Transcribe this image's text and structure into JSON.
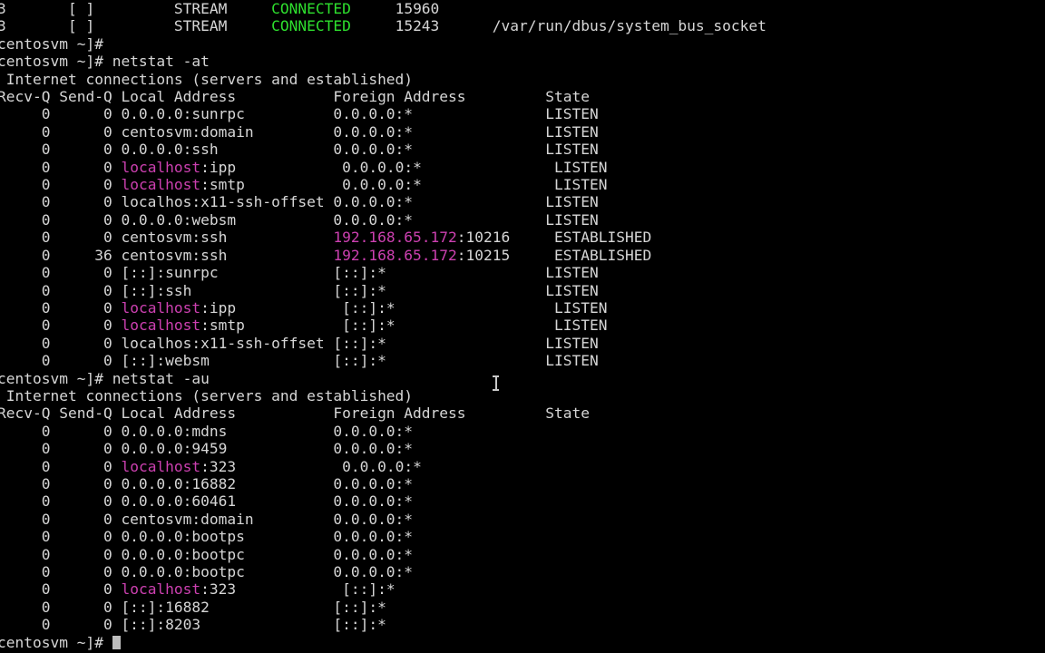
{
  "terminal": {
    "background_color": "#000000",
    "foreground_color": "#d6d6d6",
    "green_color": "#2ee02e",
    "magenta_color": "#cc40b0",
    "cursor_color": "#bdbdbd",
    "columns": 119,
    "rows": 37,
    "prompt": "centosvm ~]# ",
    "mouse_cursor_icon": "text-ibeam-cursor"
  },
  "lines": [
    {
      "id": "unix-socket-row-1",
      "segments": [
        {
          "text": "3       [ ]         STREAM     ",
          "color": "w"
        },
        {
          "text": "CONNECTED",
          "color": "gr"
        },
        {
          "text": "     15960",
          "color": "w"
        }
      ]
    },
    {
      "id": "unix-socket-row-2",
      "segments": [
        {
          "text": "3       [ ]         STREAM     ",
          "color": "w"
        },
        {
          "text": "CONNECTED",
          "color": "gr"
        },
        {
          "text": "     15243      /var/run/dbus/system_bus_socket",
          "color": "w"
        }
      ]
    },
    {
      "id": "prompt-blank",
      "segments": [
        {
          "text": "centosvm ~]# ",
          "color": "w"
        }
      ]
    },
    {
      "id": "prompt-netstat-at",
      "segments": [
        {
          "text": "centosvm ~]# netstat -at",
          "color": "w"
        }
      ]
    },
    {
      "id": "tcp-banner",
      "segments": [
        {
          "text": " Internet connections (servers and established)",
          "color": "w"
        }
      ]
    },
    {
      "id": "tcp-header",
      "segments": [
        {
          "text": "Recv-Q Send-Q Local Address           Foreign Address         State",
          "color": "w"
        }
      ]
    },
    {
      "id": "tcp-row-sunrpc",
      "segments": [
        {
          "text": "     0      0 0.0.0.0:sunrpc          0.0.0.0:*               LISTEN",
          "color": "w"
        }
      ]
    },
    {
      "id": "tcp-row-domain",
      "segments": [
        {
          "text": "     0      0 centosvm:domain         0.0.0.0:*               LISTEN",
          "color": "w"
        }
      ]
    },
    {
      "id": "tcp-row-ssh",
      "segments": [
        {
          "text": "     0      0 0.0.0.0:ssh             0.0.0.0:*               LISTEN",
          "color": "w"
        }
      ]
    },
    {
      "id": "tcp-row-ipp",
      "segments": [
        {
          "text": "     0      0 ",
          "color": "w"
        },
        {
          "text": "localhost",
          "color": "mg"
        },
        {
          "text": ":ipp            0.0.0.0:*               LISTEN",
          "color": "w"
        }
      ]
    },
    {
      "id": "tcp-row-smtp",
      "segments": [
        {
          "text": "     0      0 ",
          "color": "w"
        },
        {
          "text": "localhost",
          "color": "mg"
        },
        {
          "text": ":smtp           0.0.0.0:*               LISTEN",
          "color": "w"
        }
      ]
    },
    {
      "id": "tcp-row-x11",
      "segments": [
        {
          "text": "     0      0 localhos:x11-ssh-offset 0.0.0.0:*               LISTEN",
          "color": "w"
        }
      ]
    },
    {
      "id": "tcp-row-websm",
      "segments": [
        {
          "text": "     0      0 0.0.0.0:websm           0.0.0.0:*               LISTEN",
          "color": "w"
        }
      ]
    },
    {
      "id": "tcp-row-est-10216",
      "segments": [
        {
          "text": "     0      0 centosvm:ssh            ",
          "color": "w"
        },
        {
          "text": "192.168.65.172",
          "color": "mg"
        },
        {
          "text": ":10216     ESTABLISHED",
          "color": "w"
        }
      ]
    },
    {
      "id": "tcp-row-est-10215",
      "segments": [
        {
          "text": "     0     36 centosvm:ssh            ",
          "color": "w"
        },
        {
          "text": "192.168.65.172",
          "color": "mg"
        },
        {
          "text": ":10215     ESTABLISHED",
          "color": "w"
        }
      ]
    },
    {
      "id": "tcp6-row-sunrpc",
      "segments": [
        {
          "text": "     0      0 [::]:sunrpc             [::]:*                  LISTEN",
          "color": "w"
        }
      ]
    },
    {
      "id": "tcp6-row-ssh",
      "segments": [
        {
          "text": "     0      0 [::]:ssh                [::]:*                  LISTEN",
          "color": "w"
        }
      ]
    },
    {
      "id": "tcp6-row-ipp",
      "segments": [
        {
          "text": "     0      0 ",
          "color": "w"
        },
        {
          "text": "localhost",
          "color": "mg"
        },
        {
          "text": ":ipp            [::]:*                  LISTEN",
          "color": "w"
        }
      ]
    },
    {
      "id": "tcp6-row-smtp",
      "segments": [
        {
          "text": "     0      0 ",
          "color": "w"
        },
        {
          "text": "localhost",
          "color": "mg"
        },
        {
          "text": ":smtp           [::]:*                  LISTEN",
          "color": "w"
        }
      ]
    },
    {
      "id": "tcp6-row-x11",
      "segments": [
        {
          "text": "     0      0 localhos:x11-ssh-offset [::]:*                  LISTEN",
          "color": "w"
        }
      ]
    },
    {
      "id": "tcp6-row-websm",
      "segments": [
        {
          "text": "     0      0 [::]:websm              [::]:*                  LISTEN",
          "color": "w"
        }
      ]
    },
    {
      "id": "prompt-netstat-au",
      "segments": [
        {
          "text": "centosvm ~]# netstat -au",
          "color": "w"
        }
      ]
    },
    {
      "id": "udp-banner",
      "segments": [
        {
          "text": " Internet connections (servers and established)",
          "color": "w"
        }
      ]
    },
    {
      "id": "udp-header",
      "segments": [
        {
          "text": "Recv-Q Send-Q Local Address           Foreign Address         State",
          "color": "w"
        }
      ]
    },
    {
      "id": "udp-row-mdns",
      "segments": [
        {
          "text": "     0      0 0.0.0.0:mdns            0.0.0.0:*",
          "color": "w"
        }
      ]
    },
    {
      "id": "udp-row-9459",
      "segments": [
        {
          "text": "     0      0 0.0.0.0:9459            0.0.0.0:*",
          "color": "w"
        }
      ]
    },
    {
      "id": "udp-row-323",
      "segments": [
        {
          "text": "     0      0 ",
          "color": "w"
        },
        {
          "text": "localhost",
          "color": "mg"
        },
        {
          "text": ":323            0.0.0.0:*",
          "color": "w"
        }
      ]
    },
    {
      "id": "udp-row-16882",
      "segments": [
        {
          "text": "     0      0 0.0.0.0:16882           0.0.0.0:*",
          "color": "w"
        }
      ]
    },
    {
      "id": "udp-row-60461",
      "segments": [
        {
          "text": "     0      0 0.0.0.0:60461           0.0.0.0:*",
          "color": "w"
        }
      ]
    },
    {
      "id": "udp-row-domain",
      "segments": [
        {
          "text": "     0      0 centosvm:domain         0.0.0.0:*",
          "color": "w"
        }
      ]
    },
    {
      "id": "udp-row-bootps",
      "segments": [
        {
          "text": "     0      0 0.0.0.0:bootps          0.0.0.0:*",
          "color": "w"
        }
      ]
    },
    {
      "id": "udp-row-bootpc-1",
      "segments": [
        {
          "text": "     0      0 0.0.0.0:bootpc          0.0.0.0:*",
          "color": "w"
        }
      ]
    },
    {
      "id": "udp-row-bootpc-2",
      "segments": [
        {
          "text": "     0      0 0.0.0.0:bootpc          0.0.0.0:*",
          "color": "w"
        }
      ]
    },
    {
      "id": "udp6-row-323",
      "segments": [
        {
          "text": "     0      0 ",
          "color": "w"
        },
        {
          "text": "localhost",
          "color": "mg"
        },
        {
          "text": ":323            [::]:*",
          "color": "w"
        }
      ]
    },
    {
      "id": "udp6-row-16882",
      "segments": [
        {
          "text": "     0      0 [::]:16882              [::]:*",
          "color": "w"
        }
      ]
    },
    {
      "id": "udp6-row-8203",
      "segments": [
        {
          "text": "     0      0 [::]:8203               [::]:*",
          "color": "w"
        }
      ]
    },
    {
      "id": "prompt-final",
      "segments": [
        {
          "text": "centosvm ~]# ",
          "color": "w"
        }
      ],
      "cursor": true
    }
  ]
}
